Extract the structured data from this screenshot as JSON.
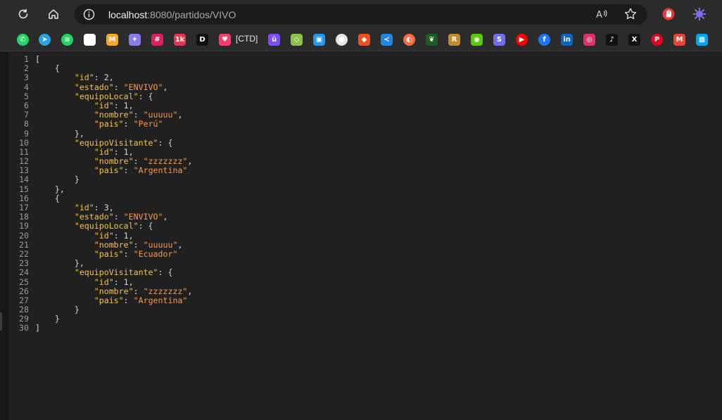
{
  "browser": {
    "url_host": "localhost",
    "url_path": ":8080/partidos/VIVO",
    "icons": {
      "reload": "reload-icon",
      "home": "home-icon",
      "info": "info-icon",
      "read_aloud": "read-aloud-icon",
      "favorite": "star-icon"
    },
    "extensions": [
      "hand-icon",
      "gear-sun-icon"
    ]
  },
  "bookmarks": {
    "items": [
      {
        "name": "whatsapp",
        "glyph": "✆",
        "color": "#25d366"
      },
      {
        "name": "telegram",
        "glyph": "➤",
        "color": "#2aa3e0"
      },
      {
        "name": "spotify",
        "glyph": "≋",
        "color": "#1ed760"
      },
      {
        "name": "chatgpt",
        "glyph": "✿",
        "color": "#ffffff"
      },
      {
        "name": "mediamarkt",
        "glyph": "M",
        "color": "#f7a823"
      },
      {
        "name": "gemini",
        "glyph": "✦",
        "color": "#8a7cf0"
      },
      {
        "name": "slack",
        "glyph": "#",
        "color": "#e01e5a"
      },
      {
        "name": "badge-1k",
        "glyph": "1k",
        "color": "#e8344e"
      },
      {
        "name": "dev",
        "glyph": "D",
        "color": "#111111"
      },
      {
        "name": "heart",
        "glyph": "♥",
        "color": "#ff3b6b"
      }
    ],
    "ctd_label": "[CTD]",
    "items2": [
      {
        "name": "u-badge",
        "glyph": "ū",
        "color": "#7c4dff"
      },
      {
        "name": "diamond",
        "glyph": "◇",
        "color": "#8bc34a"
      },
      {
        "name": "board",
        "glyph": "▣",
        "color": "#2196f3"
      },
      {
        "name": "github",
        "glyph": "●",
        "color": "#e6e6e6"
      },
      {
        "name": "figma",
        "glyph": "◆",
        "color": "#f24e1e"
      },
      {
        "name": "vscode",
        "glyph": "≺",
        "color": "#1e88e5"
      },
      {
        "name": "ring",
        "glyph": "◐",
        "color": "#ff6a3d"
      },
      {
        "name": "leaf",
        "glyph": "❦",
        "color": "#1b5e20"
      },
      {
        "name": "r-letter",
        "glyph": "R",
        "color": "#c58a2c"
      },
      {
        "name": "owl",
        "glyph": "◉",
        "color": "#58cc02"
      },
      {
        "name": "s-letter",
        "glyph": "S",
        "color": "#6f6df2"
      },
      {
        "name": "youtube",
        "glyph": "▶",
        "color": "#ff0000"
      },
      {
        "name": "facebook",
        "glyph": "f",
        "color": "#1877f2"
      },
      {
        "name": "linkedin",
        "glyph": "in",
        "color": "#0a66c2"
      },
      {
        "name": "instagram",
        "glyph": "◎",
        "color": "#e1306c"
      },
      {
        "name": "tiktok",
        "glyph": "♪",
        "color": "#111111"
      },
      {
        "name": "x",
        "glyph": "X",
        "color": "#111111"
      },
      {
        "name": "pinterest",
        "glyph": "P",
        "color": "#e60023"
      },
      {
        "name": "gmail",
        "glyph": "M",
        "color": "#ea4335"
      },
      {
        "name": "microsoft",
        "glyph": "▦",
        "color": "#00a4ef"
      }
    ]
  },
  "json_lines": [
    {
      "no": "1",
      "indent": "",
      "tokens": [
        {
          "t": "p",
          "v": "["
        }
      ]
    },
    {
      "no": "2",
      "indent": "    ",
      "tokens": [
        {
          "t": "p",
          "v": "{"
        }
      ]
    },
    {
      "no": "3",
      "indent": "        ",
      "tokens": [
        {
          "t": "k",
          "v": "\"id\""
        },
        {
          "t": "p",
          "v": ": "
        },
        {
          "t": "n",
          "v": "2"
        },
        {
          "t": "p",
          "v": ","
        }
      ]
    },
    {
      "no": "4",
      "indent": "        ",
      "tokens": [
        {
          "t": "k",
          "v": "\"estado\""
        },
        {
          "t": "p",
          "v": ": "
        },
        {
          "t": "s",
          "v": "\"ENVIVO\""
        },
        {
          "t": "p",
          "v": ","
        }
      ]
    },
    {
      "no": "5",
      "indent": "        ",
      "tokens": [
        {
          "t": "k",
          "v": "\"equipoLocal\""
        },
        {
          "t": "p",
          "v": ": {"
        }
      ]
    },
    {
      "no": "6",
      "indent": "            ",
      "tokens": [
        {
          "t": "k",
          "v": "\"id\""
        },
        {
          "t": "p",
          "v": ": "
        },
        {
          "t": "n",
          "v": "1"
        },
        {
          "t": "p",
          "v": ","
        }
      ]
    },
    {
      "no": "7",
      "indent": "            ",
      "tokens": [
        {
          "t": "k",
          "v": "\"nombre\""
        },
        {
          "t": "p",
          "v": ": "
        },
        {
          "t": "s",
          "v": "\"uuuuu\""
        },
        {
          "t": "p",
          "v": ","
        }
      ]
    },
    {
      "no": "8",
      "indent": "            ",
      "tokens": [
        {
          "t": "k",
          "v": "\"pais\""
        },
        {
          "t": "p",
          "v": ": "
        },
        {
          "t": "s",
          "v": "\"Perú\""
        }
      ]
    },
    {
      "no": "9",
      "indent": "        ",
      "tokens": [
        {
          "t": "p",
          "v": "},"
        }
      ]
    },
    {
      "no": "10",
      "indent": "        ",
      "tokens": [
        {
          "t": "k",
          "v": "\"equipoVisitante\""
        },
        {
          "t": "p",
          "v": ": {"
        }
      ]
    },
    {
      "no": "11",
      "indent": "            ",
      "tokens": [
        {
          "t": "k",
          "v": "\"id\""
        },
        {
          "t": "p",
          "v": ": "
        },
        {
          "t": "n",
          "v": "1"
        },
        {
          "t": "p",
          "v": ","
        }
      ]
    },
    {
      "no": "12",
      "indent": "            ",
      "tokens": [
        {
          "t": "k",
          "v": "\"nombre\""
        },
        {
          "t": "p",
          "v": ": "
        },
        {
          "t": "s",
          "v": "\"zzzzzzz\""
        },
        {
          "t": "p",
          "v": ","
        }
      ]
    },
    {
      "no": "13",
      "indent": "            ",
      "tokens": [
        {
          "t": "k",
          "v": "\"pais\""
        },
        {
          "t": "p",
          "v": ": "
        },
        {
          "t": "s",
          "v": "\"Argentina\""
        }
      ]
    },
    {
      "no": "14",
      "indent": "        ",
      "tokens": [
        {
          "t": "p",
          "v": "}"
        }
      ]
    },
    {
      "no": "15",
      "indent": "    ",
      "tokens": [
        {
          "t": "p",
          "v": "},"
        }
      ]
    },
    {
      "no": "16",
      "indent": "    ",
      "tokens": [
        {
          "t": "p",
          "v": "{"
        }
      ]
    },
    {
      "no": "17",
      "indent": "        ",
      "tokens": [
        {
          "t": "k",
          "v": "\"id\""
        },
        {
          "t": "p",
          "v": ": "
        },
        {
          "t": "n",
          "v": "3"
        },
        {
          "t": "p",
          "v": ","
        }
      ]
    },
    {
      "no": "18",
      "indent": "        ",
      "tokens": [
        {
          "t": "k",
          "v": "\"estado\""
        },
        {
          "t": "p",
          "v": ": "
        },
        {
          "t": "s",
          "v": "\"ENVIVO\""
        },
        {
          "t": "p",
          "v": ","
        }
      ]
    },
    {
      "no": "19",
      "indent": "        ",
      "tokens": [
        {
          "t": "k",
          "v": "\"equipoLocal\""
        },
        {
          "t": "p",
          "v": ": {"
        }
      ]
    },
    {
      "no": "20",
      "indent": "            ",
      "tokens": [
        {
          "t": "k",
          "v": "\"id\""
        },
        {
          "t": "p",
          "v": ": "
        },
        {
          "t": "n",
          "v": "1"
        },
        {
          "t": "p",
          "v": ","
        }
      ]
    },
    {
      "no": "21",
      "indent": "            ",
      "tokens": [
        {
          "t": "k",
          "v": "\"nombre\""
        },
        {
          "t": "p",
          "v": ": "
        },
        {
          "t": "s",
          "v": "\"uuuuu\""
        },
        {
          "t": "p",
          "v": ","
        }
      ]
    },
    {
      "no": "22",
      "indent": "            ",
      "tokens": [
        {
          "t": "k",
          "v": "\"pais\""
        },
        {
          "t": "p",
          "v": ": "
        },
        {
          "t": "s",
          "v": "\"Ecuador\""
        }
      ]
    },
    {
      "no": "23",
      "indent": "        ",
      "tokens": [
        {
          "t": "p",
          "v": "},"
        }
      ]
    },
    {
      "no": "24",
      "indent": "        ",
      "tokens": [
        {
          "t": "k",
          "v": "\"equipoVisitante\""
        },
        {
          "t": "p",
          "v": ": {"
        }
      ]
    },
    {
      "no": "25",
      "indent": "            ",
      "tokens": [
        {
          "t": "k",
          "v": "\"id\""
        },
        {
          "t": "p",
          "v": ": "
        },
        {
          "t": "n",
          "v": "1"
        },
        {
          "t": "p",
          "v": ","
        }
      ]
    },
    {
      "no": "26",
      "indent": "            ",
      "tokens": [
        {
          "t": "k",
          "v": "\"nombre\""
        },
        {
          "t": "p",
          "v": ": "
        },
        {
          "t": "s",
          "v": "\"zzzzzzz\""
        },
        {
          "t": "p",
          "v": ","
        }
      ]
    },
    {
      "no": "27",
      "indent": "            ",
      "tokens": [
        {
          "t": "k",
          "v": "\"pais\""
        },
        {
          "t": "p",
          "v": ": "
        },
        {
          "t": "s",
          "v": "\"Argentina\""
        }
      ]
    },
    {
      "no": "28",
      "indent": "        ",
      "tokens": [
        {
          "t": "p",
          "v": "}"
        }
      ]
    },
    {
      "no": "29",
      "indent": "    ",
      "tokens": [
        {
          "t": "p",
          "v": "}"
        }
      ]
    },
    {
      "no": "30",
      "indent": "",
      "tokens": [
        {
          "t": "p",
          "v": "]"
        }
      ]
    }
  ]
}
